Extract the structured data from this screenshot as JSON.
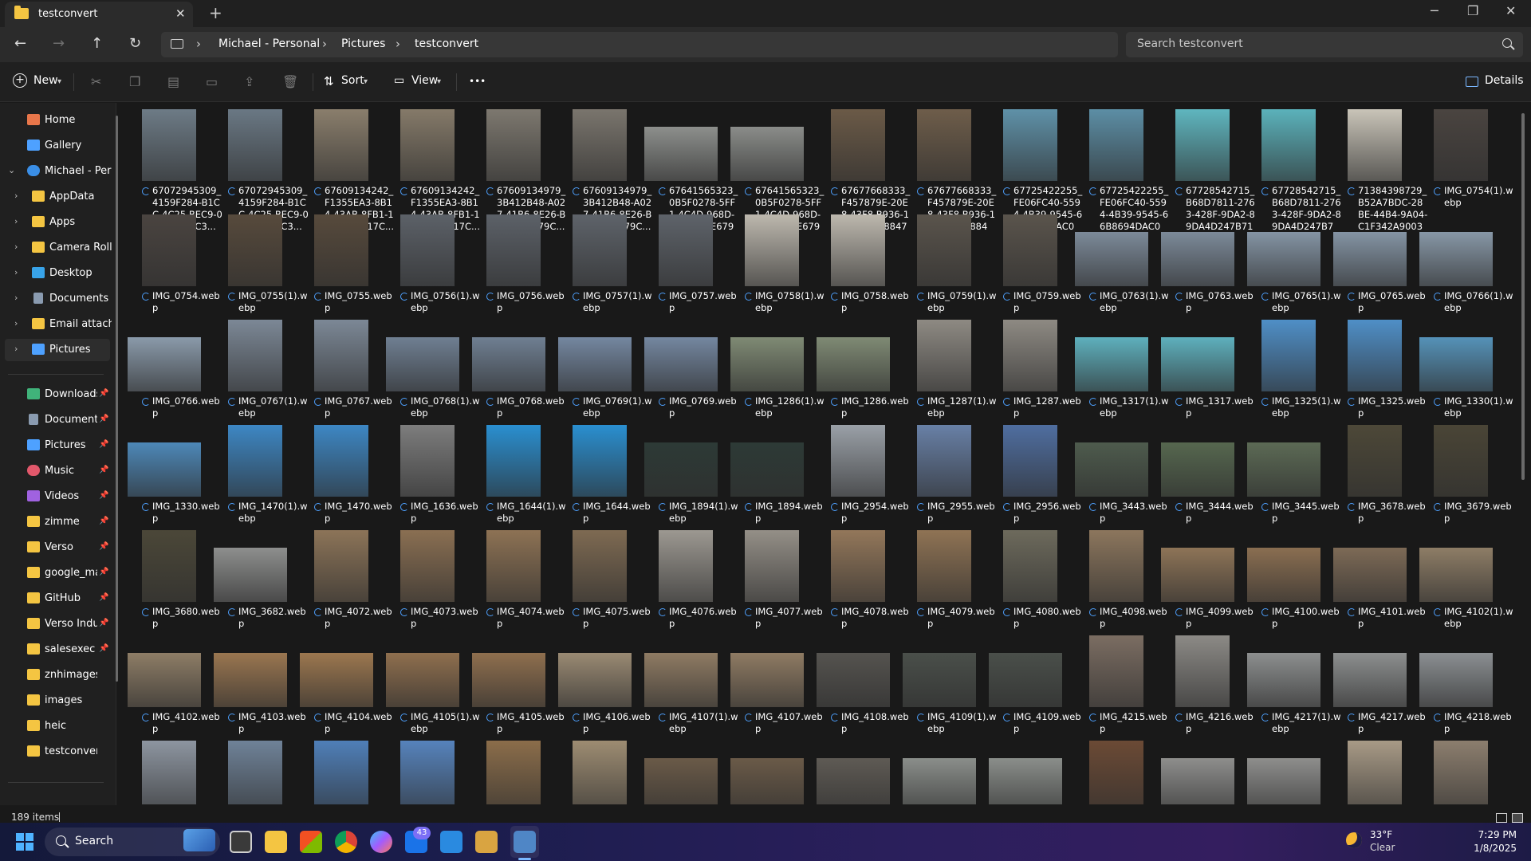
{
  "window": {
    "tab_title": "testconvert",
    "close_glyph": "✕",
    "new_tab_glyph": "+"
  },
  "address": {
    "breadcrumbs": [
      "Michael - Personal",
      "Pictures",
      "testconvert"
    ],
    "search_placeholder": "Search testconvert"
  },
  "toolbar": {
    "new_label": "New",
    "sort_label": "Sort",
    "view_label": "View",
    "more_label": "•••",
    "details_label": "Details"
  },
  "sidebar": {
    "items": [
      {
        "label": "Home",
        "icon": "home-icon",
        "color": "#e8764a"
      },
      {
        "label": "Gallery",
        "icon": "gallery-icon",
        "color": "#4ea1ff"
      },
      {
        "label": "Michael - Personal",
        "icon": "cloud-icon",
        "color": "#3a8ee6"
      },
      {
        "label": "AppData",
        "icon": "folder-icon",
        "color": "#f4c542"
      },
      {
        "label": "Apps",
        "icon": "folder-icon",
        "color": "#f4c542"
      },
      {
        "label": "Camera Roll",
        "icon": "folder-icon",
        "color": "#f4c542"
      },
      {
        "label": "Desktop",
        "icon": "desktop-icon",
        "color": "#38a3e8"
      },
      {
        "label": "Documents",
        "icon": "documents-icon",
        "color": "#8a9bb0"
      },
      {
        "label": "Email attachments",
        "icon": "folder-icon",
        "color": "#f4c542"
      },
      {
        "label": "Pictures",
        "icon": "pictures-icon",
        "color": "#4ea1ff"
      }
    ],
    "quick": [
      {
        "label": "Downloads",
        "icon": "downloads-icon",
        "color": "#40b37a"
      },
      {
        "label": "Documents",
        "icon": "documents-icon",
        "color": "#8a9bb0"
      },
      {
        "label": "Pictures",
        "icon": "pictures-icon",
        "color": "#4ea1ff"
      },
      {
        "label": "Music",
        "icon": "music-icon",
        "color": "#e2586b"
      },
      {
        "label": "Videos",
        "icon": "videos-icon",
        "color": "#a062e0"
      },
      {
        "label": "zimme",
        "icon": "folder-icon",
        "color": "#f4c542"
      },
      {
        "label": "Verso",
        "icon": "folder-icon",
        "color": "#f4c542"
      },
      {
        "label": "google_maps",
        "icon": "folder-icon",
        "color": "#f4c542"
      },
      {
        "label": "GitHub",
        "icon": "folder-icon",
        "color": "#f4c542"
      },
      {
        "label": "Verso Industries",
        "icon": "folder-icon",
        "color": "#f4c542"
      },
      {
        "label": "salesexec",
        "icon": "folder-icon",
        "color": "#f4c542"
      },
      {
        "label": "znhimages",
        "icon": "folder-icon",
        "color": "#f4c542"
      },
      {
        "label": "images",
        "icon": "folder-icon",
        "color": "#f4c542"
      },
      {
        "label": "heic",
        "icon": "folder-icon",
        "color": "#f4c542"
      },
      {
        "label": "testconvert",
        "icon": "folder-icon",
        "color": "#f4c542"
      }
    ]
  },
  "files": [
    {
      "name": "67072945309_4159F284-B1CC-4C25-BEC9-0EC893D8C3...",
      "orientation": "portrait",
      "color": "#6d7b86"
    },
    {
      "name": "67072945309_4159F284-B1CC-4C25-BEC9-0EC893D8C3...",
      "orientation": "portrait",
      "color": "#6a7884"
    },
    {
      "name": "67609134242_F1355EA3-8B14-43AB-8FB1-1DE91E2C17C...",
      "orientation": "portrait",
      "color": "#8a7e6c"
    },
    {
      "name": "67609134242_F1355EA3-8B14-43AB-8FB1-1DE91E2C17C...",
      "orientation": "portrait",
      "color": "#857a69"
    },
    {
      "name": "67609134979_3B412B48-A027-41B6-8E26-B62AE51879C...",
      "orientation": "portrait",
      "color": "#7d786f"
    },
    {
      "name": "67609134979_3B412B48-A027-41B6-8E26-B62AE51879C...",
      "orientation": "portrait",
      "color": "#7a756d"
    },
    {
      "name": "67641565323_0B5F0278-5FF1-4C4D-968D-796C813E679E...",
      "orientation": "landscape",
      "color": "#8d8f8c"
    },
    {
      "name": "67641565323_0B5F0278-5FF1-4C4D-968D-796C813E679E...",
      "orientation": "landscape",
      "color": "#8a8c89"
    },
    {
      "name": "67677668333_F457879E-20E8-43F8-B936-12C6C0C18847(...",
      "orientation": "portrait",
      "color": "#6b5a47"
    },
    {
      "name": "67677668333_F457879E-20E8-43F8-B936-12C6C0C18847....",
      "orientation": "portrait",
      "color": "#6e5d4a"
    },
    {
      "name": "67725422255_FE06FC40-5594-4B39-9545-66B8694DAC0B...",
      "orientation": "portrait",
      "color": "#5f91a8"
    },
    {
      "name": "67725422255_FE06FC40-5594-4B39-9545-66B8694DAC0B....",
      "orientation": "portrait",
      "color": "#5c8ea5"
    },
    {
      "name": "67728542715_B68D7811-2763-428F-9DA2-89DA4D247B71(...",
      "orientation": "portrait",
      "color": "#5fb6bf"
    },
    {
      "name": "67728542715_B68D7811-2763-428F-9DA2-89DA4D247B71....",
      "orientation": "portrait",
      "color": "#5bb2bb"
    },
    {
      "name": "71384398729_B52A7BDC-28BE-44B4-9A04-C1F342A9003F....",
      "orientation": "portrait",
      "color": "#c9c4b8"
    },
    {
      "name": "IMG_0754(1).webp",
      "orientation": "portrait",
      "color": "#4a4440"
    },
    {
      "name": "IMG_0754.webp",
      "orientation": "portrait",
      "color": "#4a4440"
    },
    {
      "name": "IMG_0755(1).webp",
      "orientation": "portrait",
      "color": "#574a3c"
    },
    {
      "name": "IMG_0755.webp",
      "orientation": "portrait",
      "color": "#574a3c"
    },
    {
      "name": "IMG_0756(1).webp",
      "orientation": "portrait",
      "color": "#5c6168"
    },
    {
      "name": "IMG_0756.webp",
      "orientation": "portrait",
      "color": "#5c6168"
    },
    {
      "name": "IMG_0757(1).webp",
      "orientation": "portrait",
      "color": "#5e636a"
    },
    {
      "name": "IMG_0757.webp",
      "orientation": "portrait",
      "color": "#5e636a"
    },
    {
      "name": "IMG_0758(1).webp",
      "orientation": "portrait",
      "color": "#bdb8ae"
    },
    {
      "name": "IMG_0758.webp",
      "orientation": "portrait",
      "color": "#bdb8ae"
    },
    {
      "name": "IMG_0759(1).webp",
      "orientation": "portrait",
      "color": "#5a544c"
    },
    {
      "name": "IMG_0759.webp",
      "orientation": "portrait",
      "color": "#5a544c"
    },
    {
      "name": "IMG_0763(1).webp",
      "orientation": "landscape",
      "color": "#7c8a99"
    },
    {
      "name": "IMG_0763.webp",
      "orientation": "landscape",
      "color": "#7c8a99"
    },
    {
      "name": "IMG_0765(1).webp",
      "orientation": "landscape",
      "color": "#8494a4"
    },
    {
      "name": "IMG_0765.webp",
      "orientation": "landscape",
      "color": "#8494a4"
    },
    {
      "name": "IMG_0766(1).webp",
      "orientation": "landscape",
      "color": "#8797a6"
    },
    {
      "name": "IMG_0766.webp",
      "orientation": "landscape",
      "color": "#8a9aaa"
    },
    {
      "name": "IMG_0767(1).webp",
      "orientation": "portrait",
      "color": "#7c8896"
    },
    {
      "name": "IMG_0767.webp",
      "orientation": "portrait",
      "color": "#7c8896"
    },
    {
      "name": "IMG_0768(1).webp",
      "orientation": "landscape",
      "color": "#6f7f92"
    },
    {
      "name": "IMG_0768.webp",
      "orientation": "landscape",
      "color": "#6f7f92"
    },
    {
      "name": "IMG_0769(1).webp",
      "orientation": "landscape",
      "color": "#7487a0"
    },
    {
      "name": "IMG_0769.webp",
      "orientation": "landscape",
      "color": "#7487a0"
    },
    {
      "name": "IMG_1286(1).webp",
      "orientation": "landscape",
      "color": "#7f8a74"
    },
    {
      "name": "IMG_1286.webp",
      "orientation": "landscape",
      "color": "#7f8a74"
    },
    {
      "name": "IMG_1287(1).webp",
      "orientation": "portrait",
      "color": "#8e8a83"
    },
    {
      "name": "IMG_1287.webp",
      "orientation": "portrait",
      "color": "#8e8a83"
    },
    {
      "name": "IMG_1317(1).webp",
      "orientation": "landscape",
      "color": "#5eb0bd"
    },
    {
      "name": "IMG_1317.webp",
      "orientation": "landscape",
      "color": "#5eb0bd"
    },
    {
      "name": "IMG_1325(1).webp",
      "orientation": "portrait",
      "color": "#4f8fc7"
    },
    {
      "name": "IMG_1325.webp",
      "orientation": "portrait",
      "color": "#4f8fc7"
    },
    {
      "name": "IMG_1330(1).webp",
      "orientation": "landscape",
      "color": "#5592b8"
    },
    {
      "name": "IMG_1330.webp",
      "orientation": "landscape",
      "color": "#4d88b8"
    },
    {
      "name": "IMG_1470(1).webp",
      "orientation": "portrait",
      "color": "#3d87c4"
    },
    {
      "name": "IMG_1470.webp",
      "orientation": "portrait",
      "color": "#3d87c4"
    },
    {
      "name": "IMG_1636.webp",
      "orientation": "portrait",
      "color": "#7d7d7d"
    },
    {
      "name": "IMG_1644(1).webp",
      "orientation": "portrait",
      "color": "#2a8fd0"
    },
    {
      "name": "IMG_1644.webp",
      "orientation": "portrait",
      "color": "#2a8fd0"
    },
    {
      "name": "IMG_1894(1).webp",
      "orientation": "landscape",
      "color": "#2d3a36"
    },
    {
      "name": "IMG_1894.webp",
      "orientation": "landscape",
      "color": "#2d3a36"
    },
    {
      "name": "IMG_2954.webp",
      "orientation": "portrait",
      "color": "#9aa0a7"
    },
    {
      "name": "IMG_2955.webp",
      "orientation": "portrait",
      "color": "#6880a6"
    },
    {
      "name": "IMG_2956.webp",
      "orientation": "portrait",
      "color": "#4f6ea0"
    },
    {
      "name": "IMG_3443.webp",
      "orientation": "landscape",
      "color": "#4e5b4d"
    },
    {
      "name": "IMG_3444.webp",
      "orientation": "landscape",
      "color": "#56674f"
    },
    {
      "name": "IMG_3445.webp",
      "orientation": "landscape",
      "color": "#5c6a55"
    },
    {
      "name": "IMG_3678.webp",
      "orientation": "portrait",
      "color": "#4d4838"
    },
    {
      "name": "IMG_3679.webp",
      "orientation": "portrait",
      "color": "#4a4536"
    },
    {
      "name": "IMG_3680.webp",
      "orientation": "portrait",
      "color": "#4b4738"
    },
    {
      "name": "IMG_3682.webp",
      "orientation": "landscape",
      "color": "#8e8f8e"
    },
    {
      "name": "IMG_4072.webp",
      "orientation": "portrait",
      "color": "#8c7458"
    },
    {
      "name": "IMG_4073.webp",
      "orientation": "portrait",
      "color": "#8a6f52"
    },
    {
      "name": "IMG_4074.webp",
      "orientation": "portrait",
      "color": "#8d7254"
    },
    {
      "name": "IMG_4075.webp",
      "orientation": "portrait",
      "color": "#7e6a52"
    },
    {
      "name": "IMG_4076.webp",
      "orientation": "portrait",
      "color": "#9c9891"
    },
    {
      "name": "IMG_4077.webp",
      "orientation": "portrait",
      "color": "#948f87"
    },
    {
      "name": "IMG_4078.webp",
      "orientation": "portrait",
      "color": "#93775a"
    },
    {
      "name": "IMG_4079.webp",
      "orientation": "portrait",
      "color": "#8f7354"
    },
    {
      "name": "IMG_4080.webp",
      "orientation": "portrait",
      "color": "#6d6a5c"
    },
    {
      "name": "IMG_4098.webp",
      "orientation": "portrait",
      "color": "#8c765d"
    },
    {
      "name": "IMG_4099.webp",
      "orientation": "landscape",
      "color": "#8e7457"
    },
    {
      "name": "IMG_4100.webp",
      "orientation": "landscape",
      "color": "#8a6e51"
    },
    {
      "name": "IMG_4101.webp",
      "orientation": "landscape",
      "color": "#7d6a56"
    },
    {
      "name": "IMG_4102(1).webp",
      "orientation": "landscape",
      "color": "#8e7d66"
    },
    {
      "name": "IMG_4102.webp",
      "orientation": "landscape",
      "color": "#8e7d66"
    },
    {
      "name": "IMG_4103.webp",
      "orientation": "landscape",
      "color": "#9a7650"
    },
    {
      "name": "IMG_4104.webp",
      "orientation": "landscape",
      "color": "#9c774f"
    },
    {
      "name": "IMG_4105(1).webp",
      "orientation": "landscape",
      "color": "#8f6f4e"
    },
    {
      "name": "IMG_4105.webp",
      "orientation": "landscape",
      "color": "#8f6f4e"
    },
    {
      "name": "IMG_4106.webp",
      "orientation": "landscape",
      "color": "#9a8a73"
    },
    {
      "name": "IMG_4107(1).webp",
      "orientation": "landscape",
      "color": "#8f7b63"
    },
    {
      "name": "IMG_4107.webp",
      "orientation": "landscape",
      "color": "#8f7b63"
    },
    {
      "name": "IMG_4108.webp",
      "orientation": "landscape",
      "color": "#55534f"
    },
    {
      "name": "IMG_4109(1).webp",
      "orientation": "landscape",
      "color": "#4a4f4a"
    },
    {
      "name": "IMG_4109.webp",
      "orientation": "landscape",
      "color": "#4a4f4a"
    },
    {
      "name": "IMG_4215.webp",
      "orientation": "portrait",
      "color": "#7b6d62"
    },
    {
      "name": "IMG_4216.webp",
      "orientation": "portrait",
      "color": "#8c8a86"
    },
    {
      "name": "IMG_4217(1).webp",
      "orientation": "landscape",
      "color": "#8d8f8f"
    },
    {
      "name": "IMG_4217.webp",
      "orientation": "landscape",
      "color": "#8d8f8f"
    },
    {
      "name": "IMG_4218.webp",
      "orientation": "landscape",
      "color": "#8b8f92"
    },
    {
      "name": "",
      "orientation": "portrait",
      "color": "#8d95a0"
    },
    {
      "name": "",
      "orientation": "portrait",
      "color": "#6f8298"
    },
    {
      "name": "",
      "orientation": "portrait",
      "color": "#4f7fb8"
    },
    {
      "name": "",
      "orientation": "portrait",
      "color": "#5683bc"
    },
    {
      "name": "",
      "orientation": "portrait",
      "color": "#8b6d4a"
    },
    {
      "name": "",
      "orientation": "portrait",
      "color": "#9d8c72"
    },
    {
      "name": "",
      "orientation": "landscape",
      "color": "#6a5a48"
    },
    {
      "name": "",
      "orientation": "landscape",
      "color": "#6a5a48"
    },
    {
      "name": "",
      "orientation": "landscape",
      "color": "#5e5a54"
    },
    {
      "name": "",
      "orientation": "landscape",
      "color": "#8a8e8a"
    },
    {
      "name": "",
      "orientation": "landscape",
      "color": "#8a8e8a"
    },
    {
      "name": "",
      "orientation": "portrait",
      "color": "#6b4a35"
    },
    {
      "name": "",
      "orientation": "landscape",
      "color": "#8e8e8c"
    },
    {
      "name": "",
      "orientation": "landscape",
      "color": "#8e8e8c"
    },
    {
      "name": "",
      "orientation": "portrait",
      "color": "#a89a86"
    },
    {
      "name": "",
      "orientation": "portrait",
      "color": "#8c7e6e"
    }
  ],
  "status": {
    "item_count": "189 items"
  },
  "taskbar": {
    "search_label": "Search",
    "badge_count": "43",
    "temperature": "33°F",
    "condition": "Clear",
    "time": "7:29 PM",
    "date": "1/8/2025"
  }
}
